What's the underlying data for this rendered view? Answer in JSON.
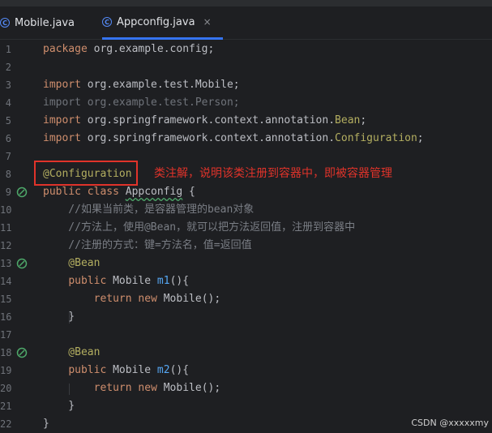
{
  "tabs": [
    {
      "label": "Mobile.java",
      "active": false
    },
    {
      "label": "Appconfig.java",
      "active": true
    }
  ],
  "tab_icon_letter": "C",
  "close_glyph": "×",
  "lines": [
    {
      "n": "1",
      "code": "package org.example.config;"
    },
    {
      "n": "2",
      "code": ""
    },
    {
      "n": "3",
      "code": "import org.example.test.Mobile;"
    },
    {
      "n": "4",
      "code": "import org.example.test.Person;"
    },
    {
      "n": "5",
      "code": "import org.springframework.context.annotation.Bean;"
    },
    {
      "n": "6",
      "code": "import org.springframework.context.annotation.Configuration;"
    },
    {
      "n": "7",
      "code": ""
    },
    {
      "n": "8",
      "code": "@Configuration"
    },
    {
      "n": "9",
      "code": "public class Appconfig {",
      "gutter_icon": "bean-icon"
    },
    {
      "n": "10",
      "code": "    //如果当前类，是容器管理的bean对象"
    },
    {
      "n": "11",
      "code": "    //方法上，使用@Bean，就可以把方法返回值，注册到容器中"
    },
    {
      "n": "12",
      "code": "    //注册的方式：键=方法名，值=返回值"
    },
    {
      "n": "13",
      "code": "    @Bean",
      "gutter_icon": "bean-icon"
    },
    {
      "n": "14",
      "code": "    public Mobile m1(){"
    },
    {
      "n": "15",
      "code": "        return new Mobile();"
    },
    {
      "n": "16",
      "code": "    }"
    },
    {
      "n": "17",
      "code": ""
    },
    {
      "n": "18",
      "code": "    @Bean",
      "gutter_icon": "bean-icon"
    },
    {
      "n": "19",
      "code": "    public Mobile m2(){"
    },
    {
      "n": "20",
      "code": "        return new Mobile();"
    },
    {
      "n": "21",
      "code": "    }"
    },
    {
      "n": "22",
      "code": "}"
    }
  ],
  "annotation_note": "类注解，说明该类注册到容器中，即被容器管理",
  "watermark": "CSDN @xxxxxmy",
  "colors": {
    "keyword": "#cf8e6d",
    "annotation": "#b3ae60",
    "method": "#56a8f5",
    "comment": "#7a7e85",
    "highlight_box": "#e0332a",
    "tab_underline": "#3574f0"
  }
}
